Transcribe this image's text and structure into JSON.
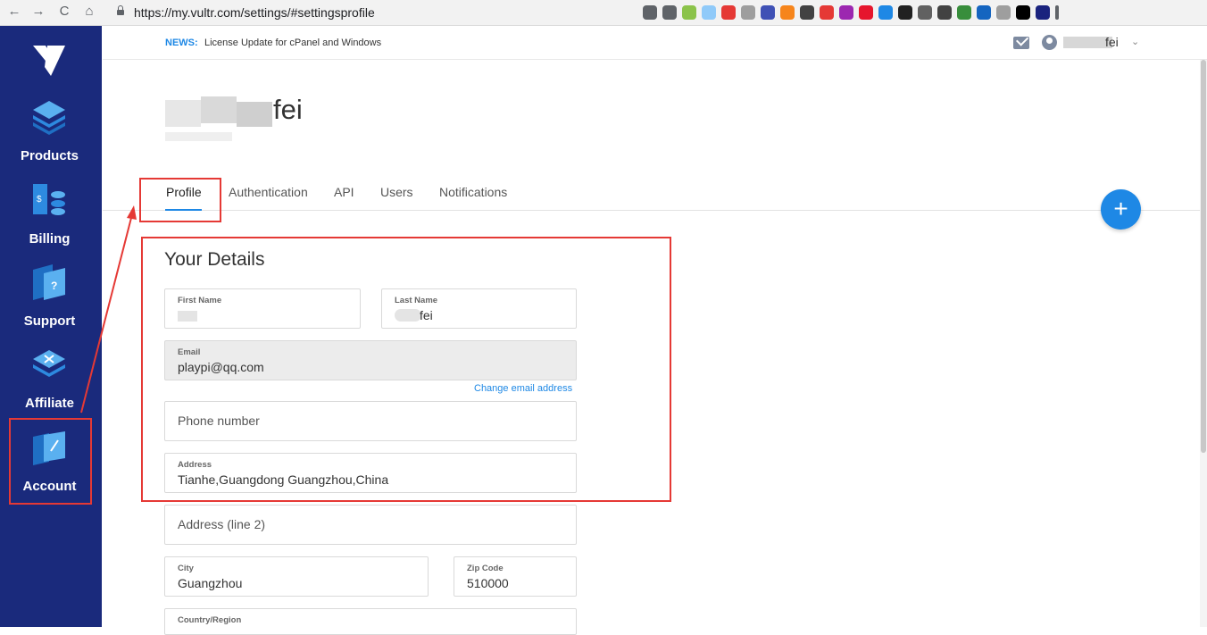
{
  "browser": {
    "url": "https://my.vultr.com/settings/#settingsprofile",
    "nav": {
      "back": "←",
      "forward": "→",
      "reload": "C",
      "home": "⌂"
    },
    "extensions": [
      {
        "name": "key-icon",
        "color": "#5f6368"
      },
      {
        "name": "star-icon",
        "color": "#5f6368"
      },
      {
        "name": "extension-green-circle-icon",
        "color": "#8bc34a"
      },
      {
        "name": "extension-cloud-icon",
        "color": "#90caf9"
      },
      {
        "name": "extension-abp-icon",
        "color": "#e53935"
      },
      {
        "name": "extension-ip-icon",
        "color": "#9e9e9e"
      },
      {
        "name": "extension-star-box-icon",
        "color": "#3f51b5"
      },
      {
        "name": "extension-metamask-icon",
        "color": "#f6851b"
      },
      {
        "name": "extension-parachute-icon",
        "color": "#424242"
      },
      {
        "name": "extension-red-circle-icon",
        "color": "#e53935"
      },
      {
        "name": "extension-purple-box-icon",
        "color": "#9c27b0"
      },
      {
        "name": "extension-weibo-icon",
        "color": "#e6162d"
      },
      {
        "name": "extension-blue-o-icon",
        "color": "#1e88e5"
      },
      {
        "name": "extension-x-box-icon",
        "color": "#212121"
      },
      {
        "name": "extension-chrome-icon",
        "color": "#616161"
      },
      {
        "name": "extension-cat-icon",
        "color": "#424242"
      },
      {
        "name": "extension-b-icon",
        "color": "#388e3c"
      },
      {
        "name": "extension-globe-icon",
        "color": "#1565c0"
      },
      {
        "name": "extension-check-icon",
        "color": "#9e9e9e"
      },
      {
        "name": "extension-jb-icon",
        "color": "#000000"
      },
      {
        "name": "extension-profile-icon",
        "color": "#1a237e"
      },
      {
        "name": "menu-dots-icon",
        "color": "#5f6368"
      }
    ]
  },
  "sidebar": {
    "items": [
      {
        "label": "Products",
        "icon": "products-layers-icon"
      },
      {
        "label": "Billing",
        "icon": "billing-coins-icon"
      },
      {
        "label": "Support",
        "icon": "support-question-icon"
      },
      {
        "label": "Affiliate",
        "icon": "affiliate-icon"
      },
      {
        "label": "Account",
        "icon": "account-folder-icon"
      }
    ]
  },
  "topbar": {
    "news_label": "NEWS:",
    "news_text": "License Update for cPanel and Windows",
    "username": "fei",
    "chevron": "⌄"
  },
  "page": {
    "name": "fei"
  },
  "tabs": [
    "Profile",
    "Authentication",
    "API",
    "Users",
    "Notifications"
  ],
  "fab": "+",
  "details": {
    "title": "Your Details",
    "first_name_label": "First Name",
    "last_name_label": "Last Name",
    "last_name_value": "fei",
    "email_label": "Email",
    "email_value": "playpi@qq.com",
    "change_email": "Change email address",
    "phone_placeholder": "Phone number",
    "address_label": "Address",
    "address_value": "Tianhe,Guangdong Guangzhou,China",
    "address2_placeholder": "Address (line 2)",
    "city_label": "City",
    "city_value": "Guangzhou",
    "zip_label": "Zip Code",
    "zip_value": "510000",
    "country_label": "Country/Region"
  },
  "colors": {
    "sidebar": "#1a2a7c",
    "accent": "#1e88e5",
    "highlight": "#e53935"
  }
}
